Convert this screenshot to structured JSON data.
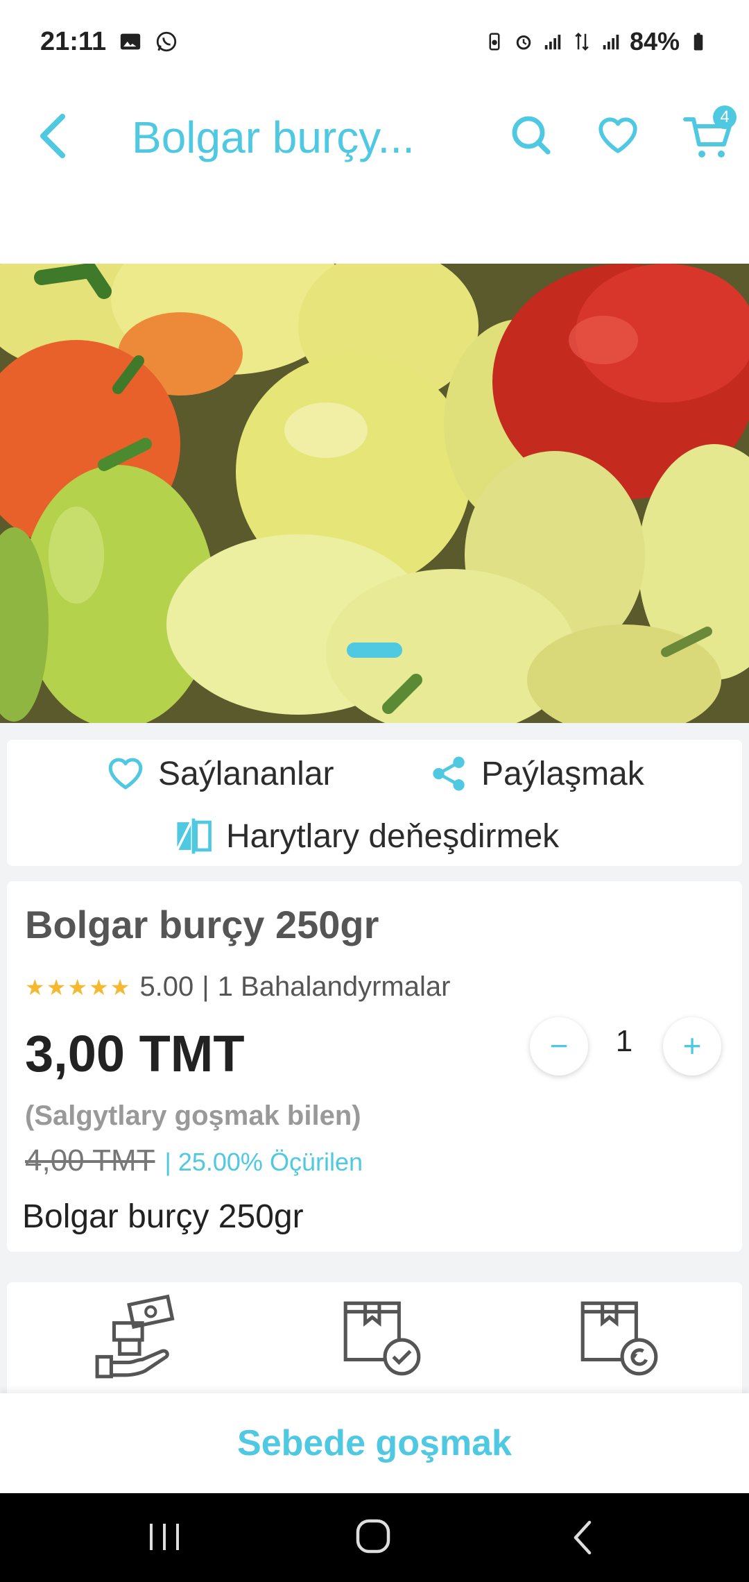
{
  "status_bar": {
    "time": "21:11",
    "battery": "84%",
    "left_icons": [
      "gallery-icon",
      "whatsapp-icon"
    ],
    "right_icons": [
      "battery-saver-icon",
      "alarm-icon",
      "signal-icon",
      "data-icon",
      "signal-icon",
      "battery-icon"
    ]
  },
  "header": {
    "title": "Bolgar burçy...",
    "cart_count": "4",
    "accent_color": "#4fc8e1"
  },
  "gallery": {
    "image_subject": "bell peppers"
  },
  "actions": {
    "favorites_label": "Saýlananlar",
    "share_label": "Paýlaşmak",
    "compare_label": "Harytlary deňeşdirmek"
  },
  "product": {
    "name": "Bolgar burçy 250gr",
    "stars": "★★★★★",
    "rating_value": "5.00",
    "rating_separator": "|",
    "reviews_text": "1 Bahalandyrmalar",
    "price": "3,00 TMT",
    "vat_note": "(Salgytlary goşmak bilen)",
    "old_price": "4,00 TMT",
    "discount": "| 25.00% Öçürilen",
    "short_description": "Bolgar burçy 250gr",
    "quantity": "1",
    "qty_minus": "−",
    "qty_plus": "+"
  },
  "cart_bar": {
    "label": "Sebede goşmak"
  }
}
